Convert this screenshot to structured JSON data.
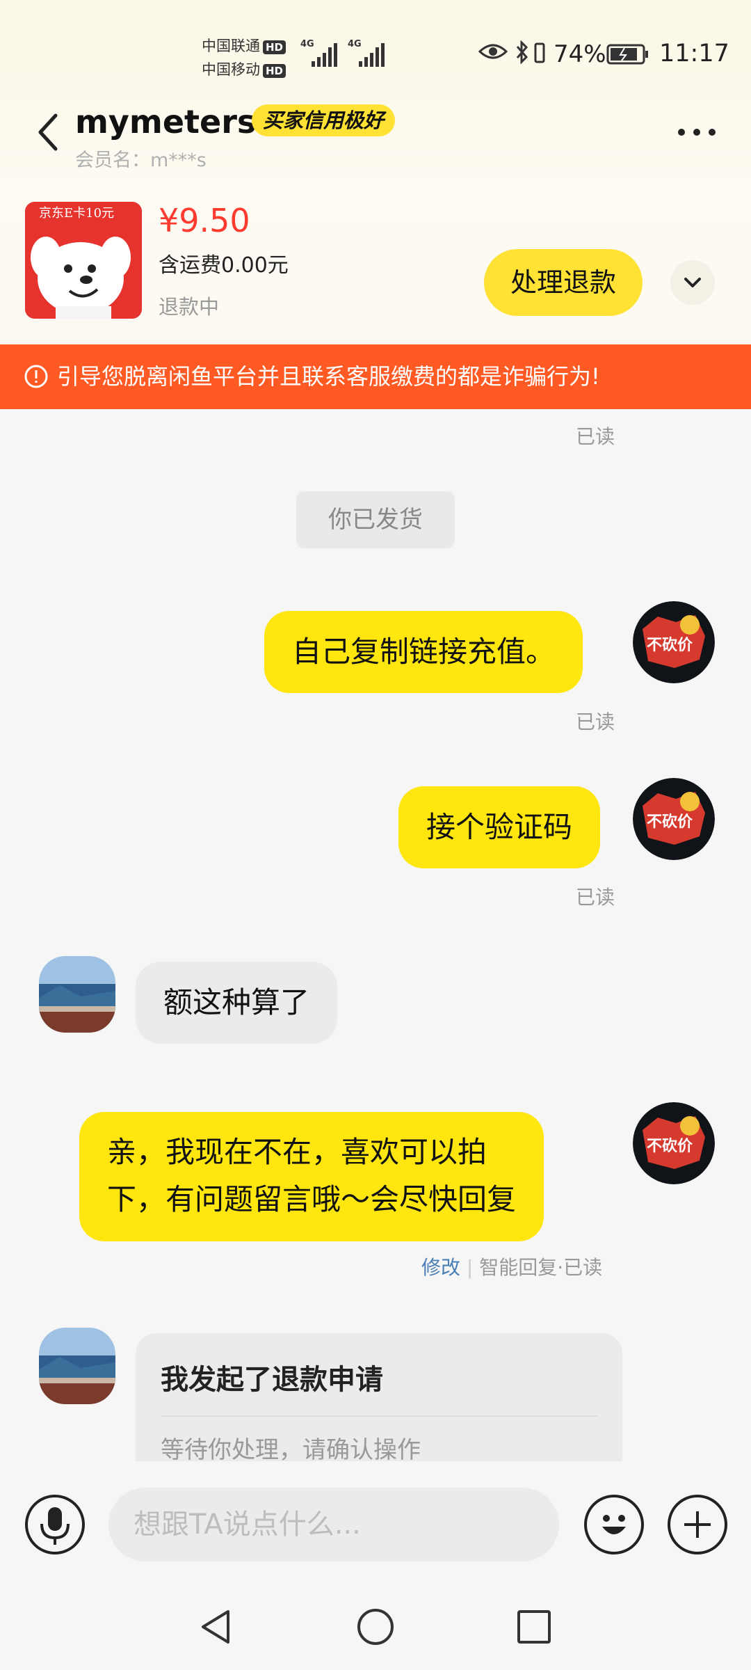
{
  "status_bar": {
    "carrier1": "中国联通",
    "carrier2": "中国移动",
    "hd_label": "HD",
    "network1": "4G",
    "network2": "4G",
    "battery": "74%",
    "time": "11:17"
  },
  "header": {
    "username": "mymeters",
    "credit_badge": "买家信用极好",
    "member_name": "会员名：m***s"
  },
  "product": {
    "thumb_text": "京东E卡10元",
    "price": "¥9.50",
    "shipping": "含运费0.00元",
    "status": "退款中",
    "refund_button": "处理退款"
  },
  "warning": {
    "text": "引导您脱离闲鱼平台并且联系客服缴费的都是诈骗行为!"
  },
  "chat": {
    "read_label": "已读",
    "system_message": "你已发货",
    "messages": [
      {
        "text": "自己复制链接充值。"
      },
      {
        "text": "接个验证码"
      },
      {
        "text": "额这种算了"
      },
      {
        "line1": "亲，我现在不在，喜欢可以拍",
        "line2": "下，有问题留言哦～会尽快回复"
      }
    ],
    "edit_label": "修改",
    "smart_reply": "智能回复·已读",
    "refund_card": {
      "title": "我发起了退款申请",
      "subtitle": "等待你处理，请确认操作"
    },
    "seller_avatar_text": "不砍价"
  },
  "input_bar": {
    "placeholder": "想跟TA说点什么..."
  }
}
